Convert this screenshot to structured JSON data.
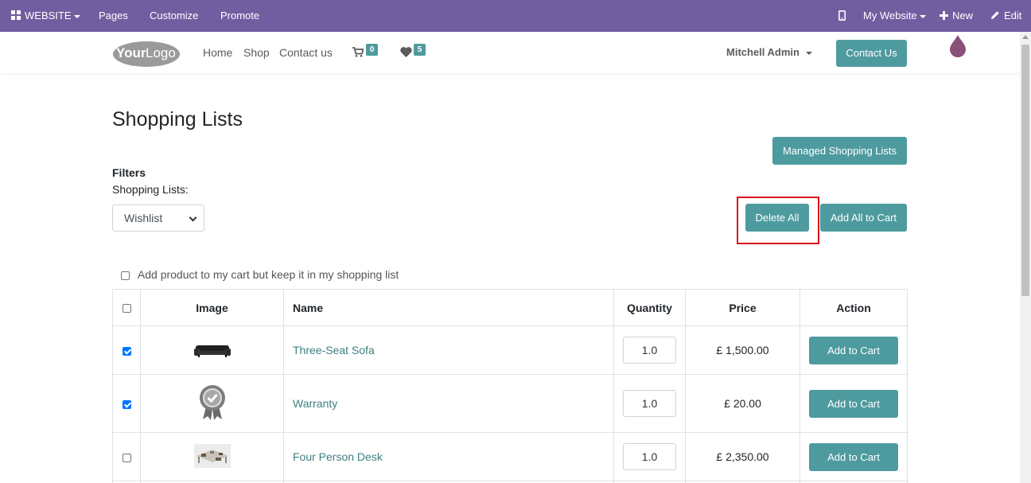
{
  "adminbar": {
    "app_label": "WEBSITE",
    "menu": [
      "Pages",
      "Customize",
      "Promote"
    ],
    "site_label": "My Website",
    "new_label": "New",
    "edit_label": "Edit"
  },
  "header": {
    "logo_text_bold": "Your",
    "logo_text_thin": "Logo",
    "nav": [
      "Home",
      "Shop",
      "Contact us"
    ],
    "cart_count": "0",
    "wishlist_count": "5",
    "user": "Mitchell Admin",
    "contact_button": "Contact Us"
  },
  "main": {
    "title": "Shopping Lists",
    "managed_button": "Managed Shopping Lists",
    "filters_heading": "Filters",
    "filters_label": "Shopping Lists:",
    "selected_list": "Wishlist",
    "delete_all": "Delete All",
    "add_all": "Add All to Cart",
    "keep_label": "Add product to my cart but keep it in my shopping list"
  },
  "table": {
    "headers": [
      "Image",
      "Name",
      "Quantity",
      "Price",
      "Action"
    ],
    "rows": [
      {
        "name": "Three-Seat Sofa",
        "qty": "1.0",
        "price": "£ 1,500.00",
        "action": "Add to Cart",
        "checked": true,
        "image": "sofa-image"
      },
      {
        "name": "Warranty",
        "qty": "1.0",
        "price": "£ 20.00",
        "action": "Add to Cart",
        "checked": true,
        "image": "warranty-badge-image"
      },
      {
        "name": "Four Person Desk",
        "qty": "1.0",
        "price": "£ 2,350.00",
        "action": "Add to Cart",
        "checked": false,
        "image": "desk-image"
      }
    ]
  },
  "colors": {
    "admin_bar": "#715ea0",
    "accent": "#4e9b9f",
    "highlight": "#d9151b",
    "link": "#3f7f80"
  }
}
